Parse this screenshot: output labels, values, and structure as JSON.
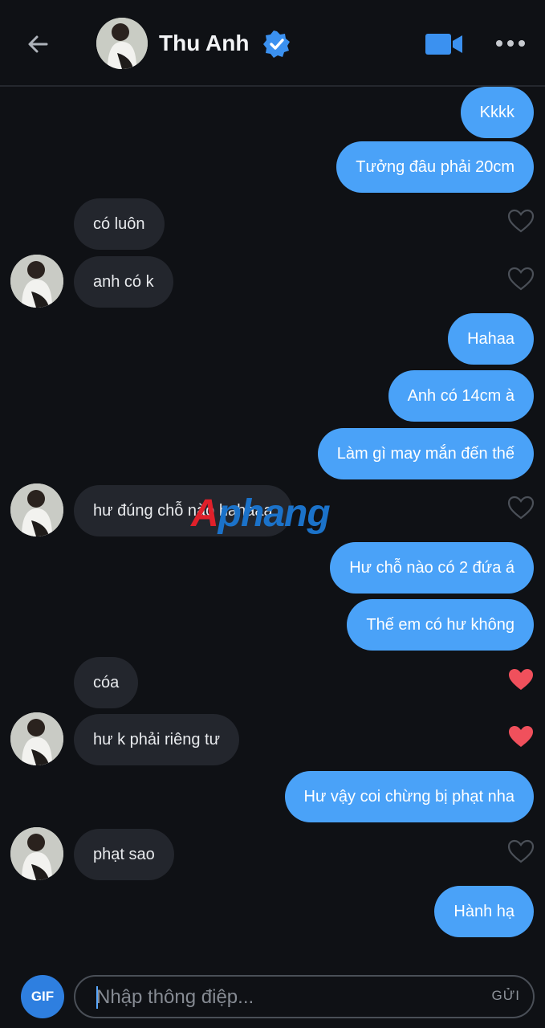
{
  "header": {
    "name": "Thu Anh",
    "verified": true,
    "icons": [
      "back-arrow-icon",
      "avatar",
      "verified-badge-icon",
      "video-call-icon",
      "more-icon"
    ],
    "accent_color": "#4aa2f8"
  },
  "messages": [
    {
      "dir": "out",
      "text": "Kkkk"
    },
    {
      "dir": "out",
      "text": "Tưởng đâu phải 20cm"
    },
    {
      "dir": "in",
      "text": "có luôn",
      "liked": false
    },
    {
      "dir": "in",
      "text": "anh có k",
      "liked": false
    },
    {
      "dir": "out",
      "text": "Hahaa"
    },
    {
      "dir": "out",
      "text": "Anh có 14cm à"
    },
    {
      "dir": "out",
      "text": "Làm gì may mắn đến thế"
    },
    {
      "dir": "in",
      "text": "hư đúng chỗ nào hahaaa",
      "liked": false
    },
    {
      "dir": "out",
      "text": "Hư chỗ nào có 2 đứa á"
    },
    {
      "dir": "out",
      "text": "Thế em có hư không"
    },
    {
      "dir": "in",
      "text": "cóa",
      "liked": true
    },
    {
      "dir": "in",
      "text": "hư k phải riêng tư",
      "liked": true
    },
    {
      "dir": "out",
      "text": "Hư vậy coi chừng bị phạt nha"
    },
    {
      "dir": "in",
      "text": "phạt sao",
      "liked": false
    },
    {
      "dir": "out",
      "text": "Hành hạ"
    }
  ],
  "watermark": {
    "first": "A",
    "rest": "phang"
  },
  "composer": {
    "gif_label": "GIF",
    "placeholder": "Nhập thông điệp...",
    "send_label": "GỬI"
  },
  "colors": {
    "background": "#0f1115",
    "outgoing_bubble": "#4aa2f8",
    "incoming_bubble": "#23262d",
    "heart_liked": "#f0505c"
  }
}
